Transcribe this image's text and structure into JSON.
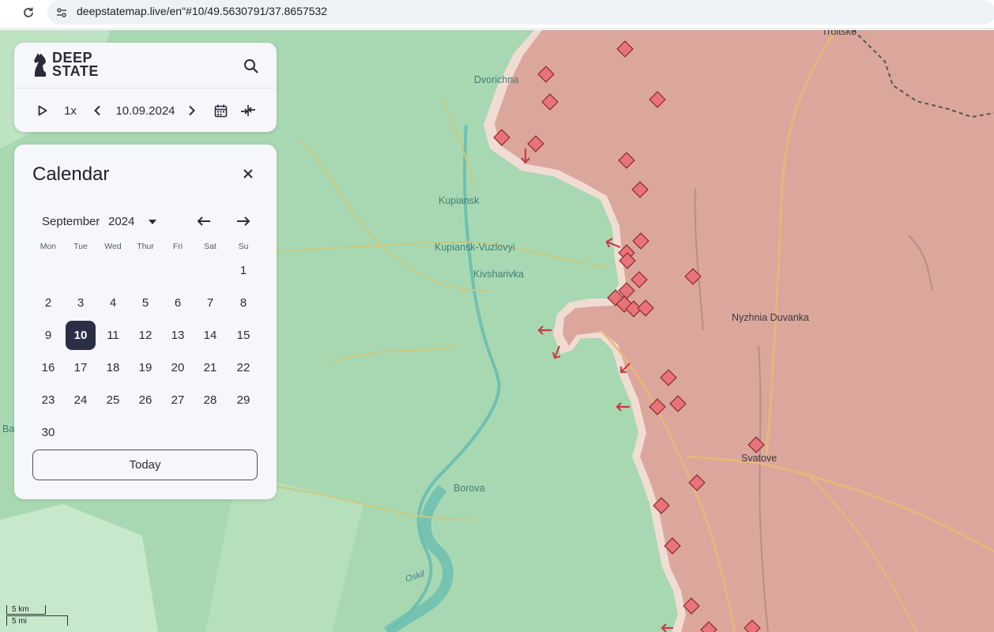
{
  "browser": {
    "url": "deepstatemap.live/en\"#10/49.5630791/37.8657532"
  },
  "map": {
    "colors": {
      "controlled_ua": "#a8d8b2",
      "occupied": "#dba79c",
      "frontline_edge": "#f1dcd3",
      "roads": "#e8b877",
      "water": "#6fc0b0"
    },
    "places": {
      "dvorichna": "Dvorichna",
      "kupiansk": "Kupiansk",
      "kupiansk_vuzlovyi": "Kupiansk-Vuzlovyi",
      "kivsharivka": "Kivsharivka",
      "nyzhnia_duvanka": "Nyzhnia Duvanka",
      "svatove": "Svatove",
      "borova": "Borova",
      "oskil": "Oskil",
      "troitske": "Troitske",
      "ba": "Ba"
    },
    "scale": {
      "km": "5 km",
      "mi": "5 mi"
    },
    "icons": {
      "attack_marker": "diamond-grid-icon",
      "direction_arrow": "arrow-icon"
    }
  },
  "logo": {
    "line1": "DEEP",
    "line2": "STATE"
  },
  "controls": {
    "speed": "1x",
    "date": "10.09.2024"
  },
  "calendar": {
    "title": "Calendar",
    "month": "September",
    "year": "2024",
    "weekdays": [
      "Mon",
      "Tue",
      "Wed",
      "Thur",
      "Fri",
      "Sat",
      "Su"
    ],
    "weeks": [
      [
        "",
        "",
        "",
        "",
        "",
        "",
        "1"
      ],
      [
        "2",
        "3",
        "4",
        "5",
        "6",
        "7",
        "8"
      ],
      [
        "9",
        "10",
        "11",
        "12",
        "13",
        "14",
        "15"
      ],
      [
        "16",
        "17",
        "18",
        "19",
        "20",
        "21",
        "22"
      ],
      [
        "23",
        "24",
        "25",
        "26",
        "27",
        "28",
        "29"
      ],
      [
        "30",
        "",
        "",
        "",
        "",
        "",
        ""
      ]
    ],
    "selected_day": "10",
    "today_label": "Today"
  }
}
